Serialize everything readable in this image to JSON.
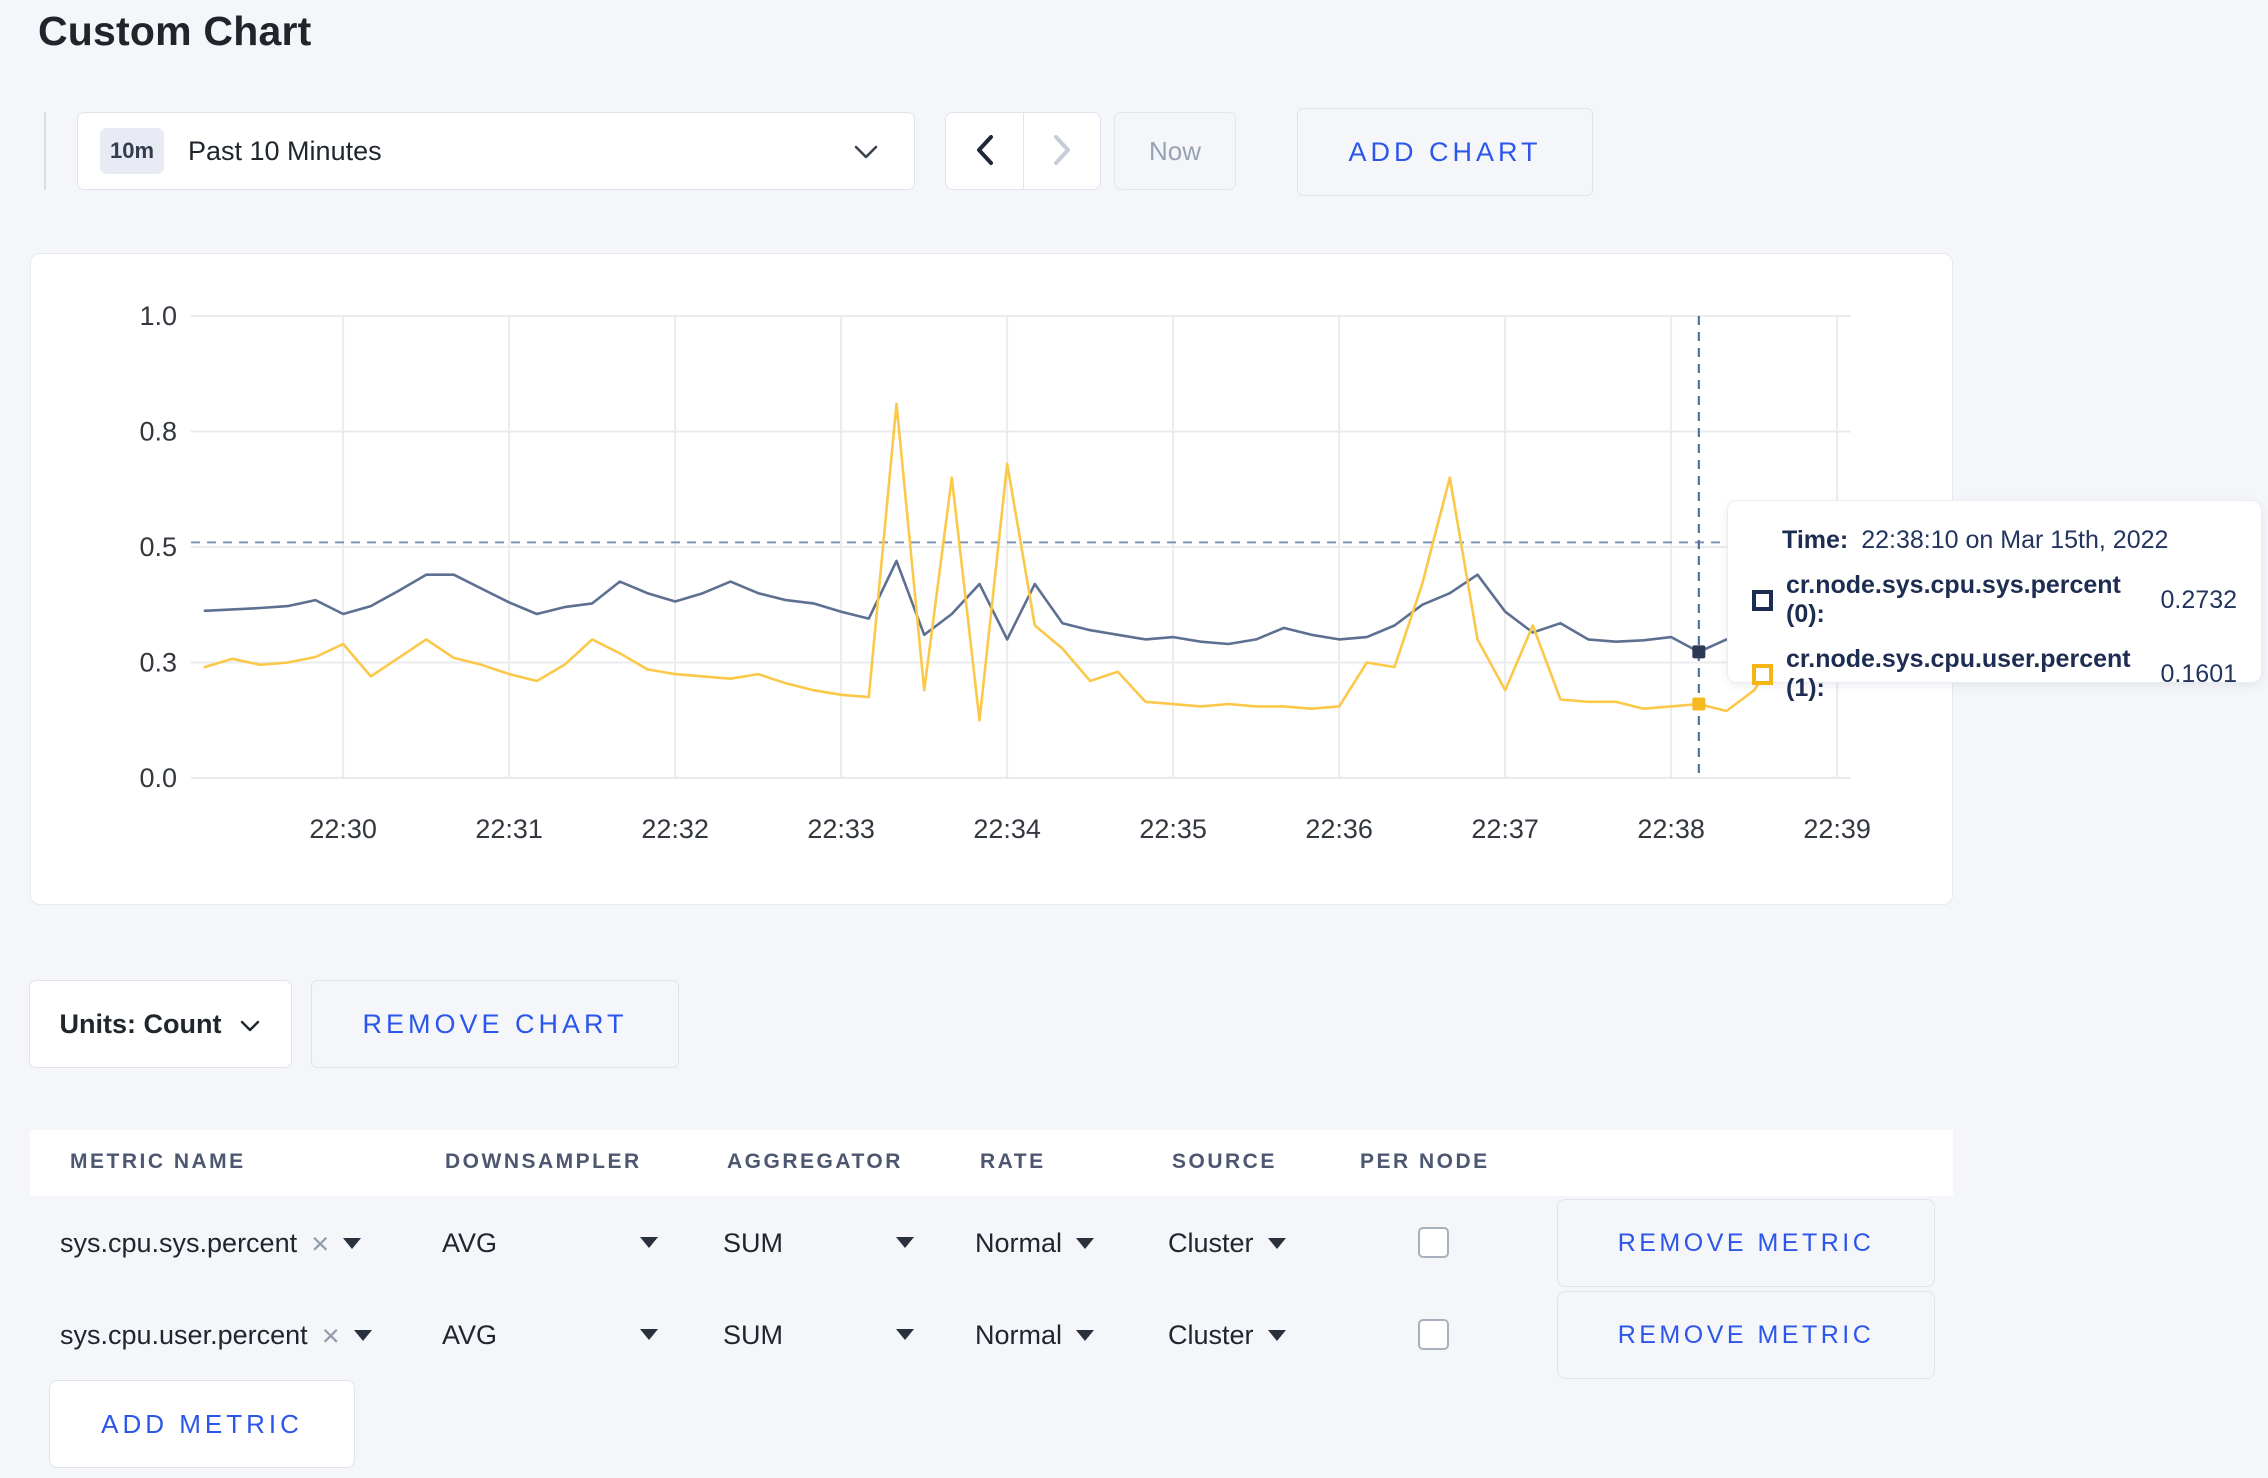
{
  "page": {
    "title": "Custom Chart",
    "background_color": "#f4f6fa",
    "accent_blue": "#2c56e9"
  },
  "toolbar": {
    "range_badge": "10m",
    "range_label": "Past 10 Minutes",
    "prev_icon": "chevron-left",
    "next_icon": "chevron-right",
    "now_label": "Now",
    "add_chart_label": "ADD CHART"
  },
  "chart_data": {
    "type": "line",
    "title": "",
    "xlabel": "",
    "ylabel": "",
    "ylim": [
      0,
      1
    ],
    "grid": true,
    "legend_position": "tooltip",
    "x_domain_seconds": 600,
    "x_domain_start_label": "22:29:05",
    "start_offset_seconds": 5,
    "sample_interval_seconds": 10,
    "x_ticks": [
      {
        "t": 55,
        "label": "22:30"
      },
      {
        "t": 115,
        "label": "22:31"
      },
      {
        "t": 175,
        "label": "22:32"
      },
      {
        "t": 235,
        "label": "22:33"
      },
      {
        "t": 295,
        "label": "22:34"
      },
      {
        "t": 355,
        "label": "22:35"
      },
      {
        "t": 415,
        "label": "22:36"
      },
      {
        "t": 475,
        "label": "22:37"
      },
      {
        "t": 535,
        "label": "22:38"
      },
      {
        "t": 595,
        "label": "22:39"
      }
    ],
    "y_ticks": [
      {
        "v": 0.0,
        "label": "0.0"
      },
      {
        "v": 0.25,
        "label": "0.3"
      },
      {
        "v": 0.5,
        "label": "0.5"
      },
      {
        "v": 0.75,
        "label": "0.8"
      },
      {
        "v": 1.0,
        "label": "1.0"
      }
    ],
    "series": [
      {
        "name": "cr.node.sys.cpu.sys.percent",
        "color": "#5e7092",
        "dot_color": "#2c3a55",
        "values": [
          0.362,
          0.365,
          0.368,
          0.372,
          0.385,
          0.355,
          0.372,
          0.405,
          0.44,
          0.44,
          0.41,
          0.38,
          0.355,
          0.37,
          0.378,
          0.425,
          0.4,
          0.382,
          0.4,
          0.425,
          0.4,
          0.385,
          0.378,
          0.36,
          0.345,
          0.47,
          0.31,
          0.355,
          0.42,
          0.3,
          0.42,
          0.335,
          0.32,
          0.31,
          0.3,
          0.305,
          0.295,
          0.29,
          0.3,
          0.325,
          0.31,
          0.3,
          0.305,
          0.33,
          0.375,
          0.4,
          0.44,
          0.36,
          0.315,
          0.335,
          0.3,
          0.295,
          0.298,
          0.305,
          0.273,
          0.3,
          0.295,
          0.3,
          0.3,
          0.305
        ]
      },
      {
        "name": "cr.node.sys.cpu.user.percent",
        "color": "#fbc84a",
        "dot_color": "#f5b923",
        "values": [
          0.24,
          0.258,
          0.245,
          0.25,
          0.262,
          0.29,
          0.22,
          0.26,
          0.3,
          0.26,
          0.245,
          0.225,
          0.21,
          0.245,
          0.3,
          0.27,
          0.235,
          0.225,
          0.22,
          0.215,
          0.225,
          0.205,
          0.19,
          0.18,
          0.175,
          0.81,
          0.19,
          0.65,
          0.125,
          0.68,
          0.33,
          0.28,
          0.21,
          0.23,
          0.165,
          0.16,
          0.155,
          0.16,
          0.155,
          0.155,
          0.15,
          0.155,
          0.25,
          0.24,
          0.42,
          0.65,
          0.3,
          0.19,
          0.33,
          0.17,
          0.165,
          0.165,
          0.15,
          0.155,
          0.1601,
          0.145,
          0.19,
          0.285,
          0.28,
          0.225
        ]
      }
    ],
    "crosshair": {
      "t": 545,
      "time_label": "22:38:10",
      "vline_color": "#54719c",
      "hline_value": 0.51,
      "hline_color": "#7d93b5"
    },
    "gridline_color": "#eaebee",
    "axis_label_color": "#33383f"
  },
  "tooltip": {
    "time_label": "Time:",
    "time_value": "22:38:10 on Mar 15th, 2022",
    "entries": [
      {
        "label": "cr.node.sys.cpu.sys.percent (0):",
        "value": "0.2732",
        "swatch_color": "#1d2d52"
      },
      {
        "label": "cr.node.sys.cpu.user.percent (1):",
        "value": "0.1601",
        "swatch_color": "#f6b514"
      }
    ]
  },
  "chart_controls": {
    "units_label": "Units: Count",
    "remove_chart_label": "REMOVE CHART"
  },
  "metrics_table": {
    "columns": [
      "METRIC NAME",
      "DOWNSAMPLER",
      "AGGREGATOR",
      "RATE",
      "SOURCE",
      "PER NODE"
    ],
    "rows": [
      {
        "metric": "sys.cpu.sys.percent",
        "downsampler": "AVG",
        "aggregator": "SUM",
        "rate": "Normal",
        "source": "Cluster",
        "per_node_checked": false,
        "remove_label": "REMOVE METRIC"
      },
      {
        "metric": "sys.cpu.user.percent",
        "downsampler": "AVG",
        "aggregator": "SUM",
        "rate": "Normal",
        "source": "Cluster",
        "per_node_checked": false,
        "remove_label": "REMOVE METRIC"
      }
    ],
    "add_metric_label": "ADD METRIC"
  }
}
